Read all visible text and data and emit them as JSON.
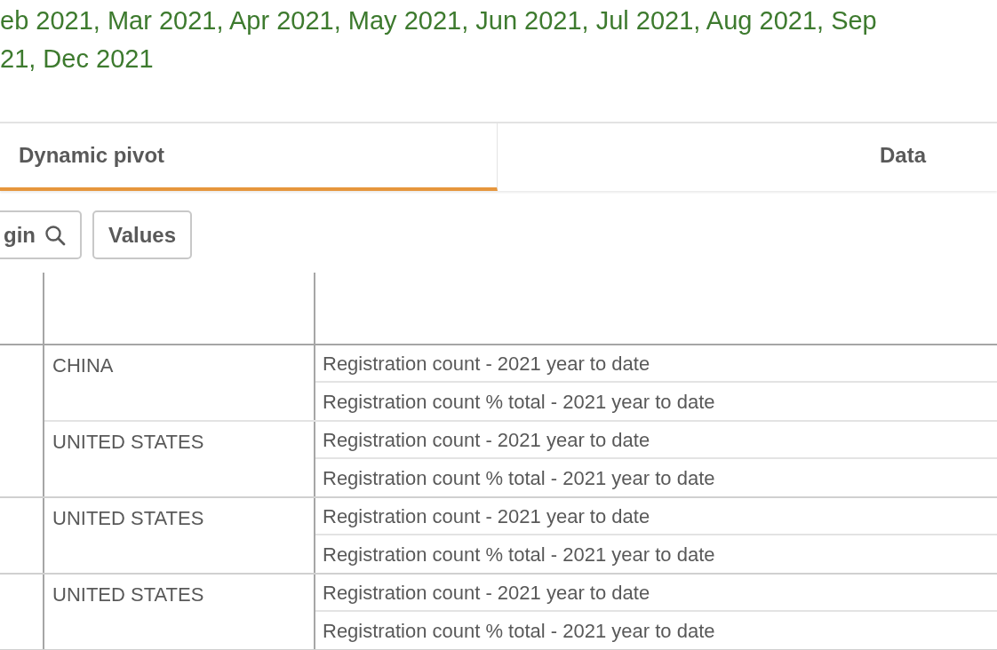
{
  "filter_text": [
    "eb 2021, Mar 2021, Apr 2021, May 2021, Jun 2021, Jul 2021, Aug 2021, Sep",
    "21, Dec 2021"
  ],
  "tabs": [
    {
      "label": "Dynamic pivot",
      "selected": true
    },
    {
      "label": "Data",
      "selected": false
    }
  ],
  "toolbar": [
    {
      "label": "gin",
      "kind": "search"
    },
    {
      "label": "Values",
      "kind": "plain"
    }
  ],
  "table": {
    "rows": [
      {
        "children": [
          {
            "country": "CHINA",
            "measures": [
              "Registration count - 2021 year to date",
              "Registration count % total - 2021 year to date"
            ]
          },
          {
            "country": "UNITED STATES",
            "measures": [
              "Registration count - 2021 year to date",
              "Registration count % total - 2021 year to date"
            ]
          }
        ]
      },
      {
        "children": [
          {
            "country": "UNITED STATES",
            "measures": [
              "Registration count - 2021 year to date",
              "Registration count % total - 2021 year to date"
            ]
          }
        ]
      },
      {
        "children": [
          {
            "country": "UNITED STATES",
            "measures": [
              "Registration count - 2021 year to date",
              "Registration count % total - 2021 year to date"
            ]
          }
        ]
      }
    ]
  }
}
